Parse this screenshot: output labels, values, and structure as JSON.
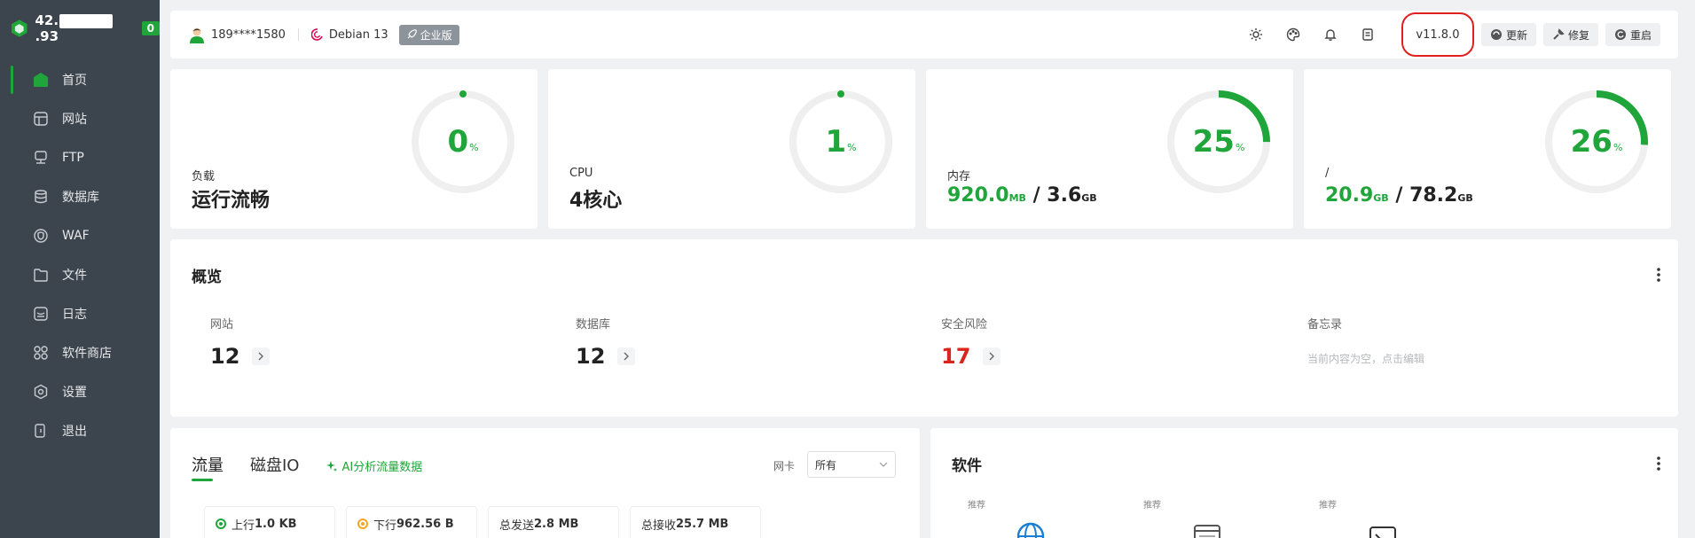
{
  "sidebar": {
    "ip_left": "42.",
    "ip_right": ".93",
    "badge": "0",
    "items": [
      {
        "label": "首页",
        "icon": "home-icon"
      },
      {
        "label": "网站",
        "icon": "website-icon"
      },
      {
        "label": "FTP",
        "icon": "ftp-icon"
      },
      {
        "label": "数据库",
        "icon": "database-icon"
      },
      {
        "label": "WAF",
        "icon": "waf-shield-icon"
      },
      {
        "label": "文件",
        "icon": "folder-icon"
      },
      {
        "label": "日志",
        "icon": "log-icon"
      },
      {
        "label": "软件商店",
        "icon": "app-store-icon"
      },
      {
        "label": "设置",
        "icon": "settings-icon"
      },
      {
        "label": "退出",
        "icon": "logout-icon"
      }
    ]
  },
  "topbar": {
    "user": "189****1580",
    "os": "Debian 13",
    "edition": "企业版",
    "version": "v11.8.0",
    "update_label": "更新",
    "repair_label": "修复",
    "restart_label": "重启"
  },
  "stats": {
    "load": {
      "label": "负载",
      "value": "运行流畅",
      "percent": "0",
      "unit": "%",
      "fraction": 0
    },
    "cpu": {
      "label": "CPU",
      "value": "4核心",
      "percent": "1",
      "unit": "%",
      "fraction": 0.01
    },
    "memory": {
      "label": "内存",
      "used": "920.0",
      "used_unit": "MB",
      "sep": " / ",
      "total": "3.6",
      "total_unit": "GB",
      "percent": "25",
      "unit": "%",
      "fraction": 0.25
    },
    "disk": {
      "label": "/",
      "used": "20.9",
      "used_unit": "GB",
      "sep": " / ",
      "total": "78.2",
      "total_unit": "GB",
      "percent": "26",
      "unit": "%",
      "fraction": 0.26
    }
  },
  "overview": {
    "title": "概览",
    "sites_label": "网站",
    "sites_value": "12",
    "db_label": "数据库",
    "db_value": "12",
    "risk_label": "安全风险",
    "risk_value": "17",
    "memo_label": "备忘录",
    "memo_text": "当前内容为空，点击编辑"
  },
  "traffic": {
    "tab_traffic": "流量",
    "tab_disk": "磁盘IO",
    "ai_link": "AI分析流量数据",
    "nic_label": "网卡",
    "nic_value": "所有",
    "up_label": "上行",
    "up_value": "1.0 KB",
    "down_label": "下行",
    "down_value": "962.56 B",
    "sent_label": "总发送",
    "sent_value": "2.8 MB",
    "recv_label": "总接收",
    "recv_value": "25.7 MB"
  },
  "software": {
    "title": "软件",
    "rec1": "推荐",
    "rec2": "推荐",
    "rec3": "推荐"
  },
  "colors": {
    "accent": "#20a53a",
    "danger": "#d9261c",
    "sidebar": "#3c444d",
    "version_highlight": "#e02020"
  }
}
